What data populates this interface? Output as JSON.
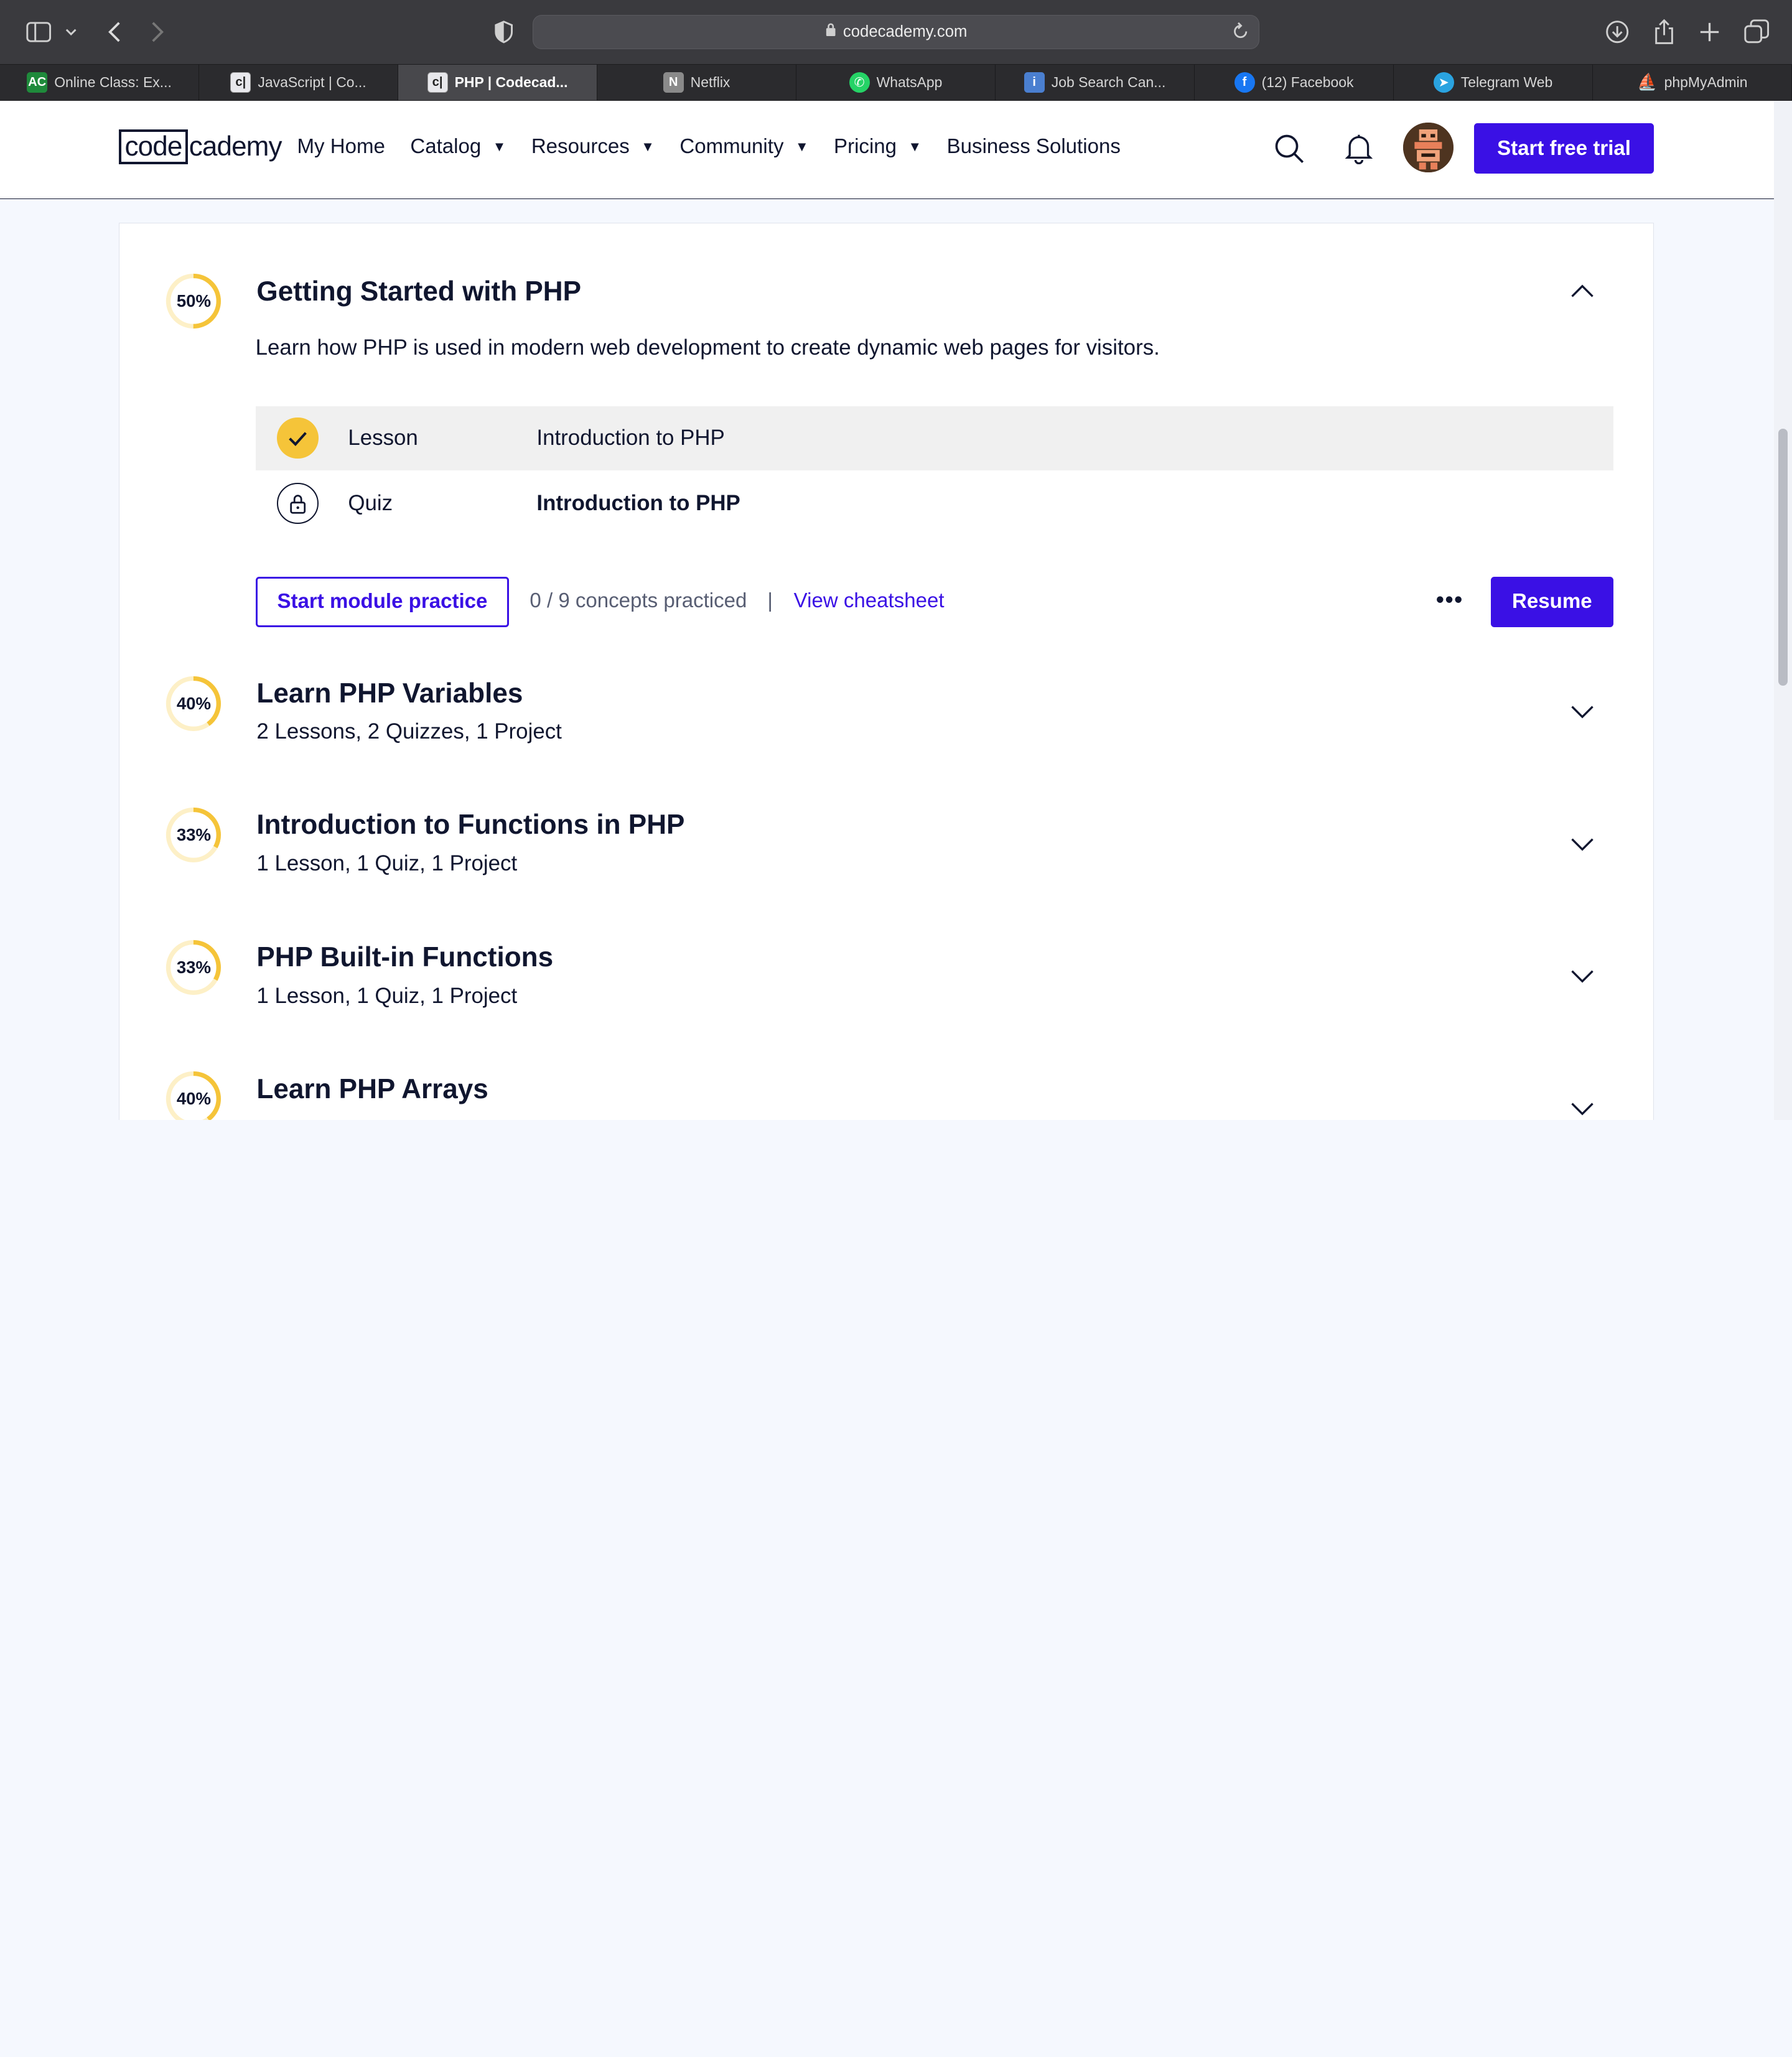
{
  "browser": {
    "url": "codecademy.com",
    "tabs": [
      {
        "label": "Online Class: Ex...",
        "favicon": "AC",
        "color": "#1f8a3b"
      },
      {
        "label": "JavaScript | Co...",
        "favicon": "c|",
        "color": "#4a4a55"
      },
      {
        "label": "PHP | Codecad...",
        "favicon": "c|",
        "color": "#4a4a55",
        "active": true
      },
      {
        "label": "Netflix",
        "favicon": "N",
        "color": "#888888"
      },
      {
        "label": "WhatsApp",
        "favicon": "whatsapp-icon",
        "color": "#25d366"
      },
      {
        "label": "Job Search Can...",
        "favicon": "i",
        "color": "#4a7fd0"
      },
      {
        "label": "(12) Facebook",
        "favicon": "f",
        "color": "#1877f2"
      },
      {
        "label": "Telegram Web",
        "favicon": "telegram-icon",
        "color": "#2aa3e0"
      },
      {
        "label": "phpMyAdmin",
        "favicon": "phpmyadmin-icon",
        "color": "#f29111"
      }
    ]
  },
  "header": {
    "logo_box": "code",
    "logo_rest": "cademy",
    "nav": [
      {
        "label": "My Home",
        "dropdown": false
      },
      {
        "label": "Catalog",
        "dropdown": true
      },
      {
        "label": "Resources",
        "dropdown": true
      },
      {
        "label": "Community",
        "dropdown": true
      },
      {
        "label": "Pricing",
        "dropdown": true
      },
      {
        "label": "Business Solutions",
        "dropdown": false
      }
    ],
    "cta": "Start free trial"
  },
  "colors": {
    "accent": "#3a10e5",
    "progress": "#f5c439",
    "navy": "#10162f"
  },
  "expanded_module": {
    "progress_label": "50%",
    "progress": 0.5,
    "title": "Getting Started with PHP",
    "description": "Learn how PHP is used in modern web development to create dynamic web pages for visitors.",
    "items": [
      {
        "type": "Lesson",
        "name": "Introduction to PHP",
        "status": "complete"
      },
      {
        "type": "Quiz",
        "name": "Introduction to PHP",
        "status": "locked"
      }
    ],
    "practice_button": "Start module practice",
    "concepts": "0 / 9 concepts practiced",
    "separator": "|",
    "cheatsheet": "View cheatsheet",
    "more": "•••",
    "resume": "Resume"
  },
  "modules": [
    {
      "progress_label": "40%",
      "progress": 0.4,
      "title": "Learn PHP Variables",
      "summary": "2 Lessons, 2 Quizzes, 1 Project"
    },
    {
      "progress_label": "33%",
      "progress": 0.33,
      "title": "Introduction to Functions in PHP",
      "summary": "1 Lesson, 1 Quiz, 1 Project"
    },
    {
      "progress_label": "33%",
      "progress": 0.33,
      "title": "PHP Built-in Functions",
      "summary": "1 Lesson, 1 Quiz, 1 Project"
    },
    {
      "progress_label": "40%",
      "progress": 0.4,
      "title": "Learn PHP Arrays",
      "summary": ""
    }
  ]
}
